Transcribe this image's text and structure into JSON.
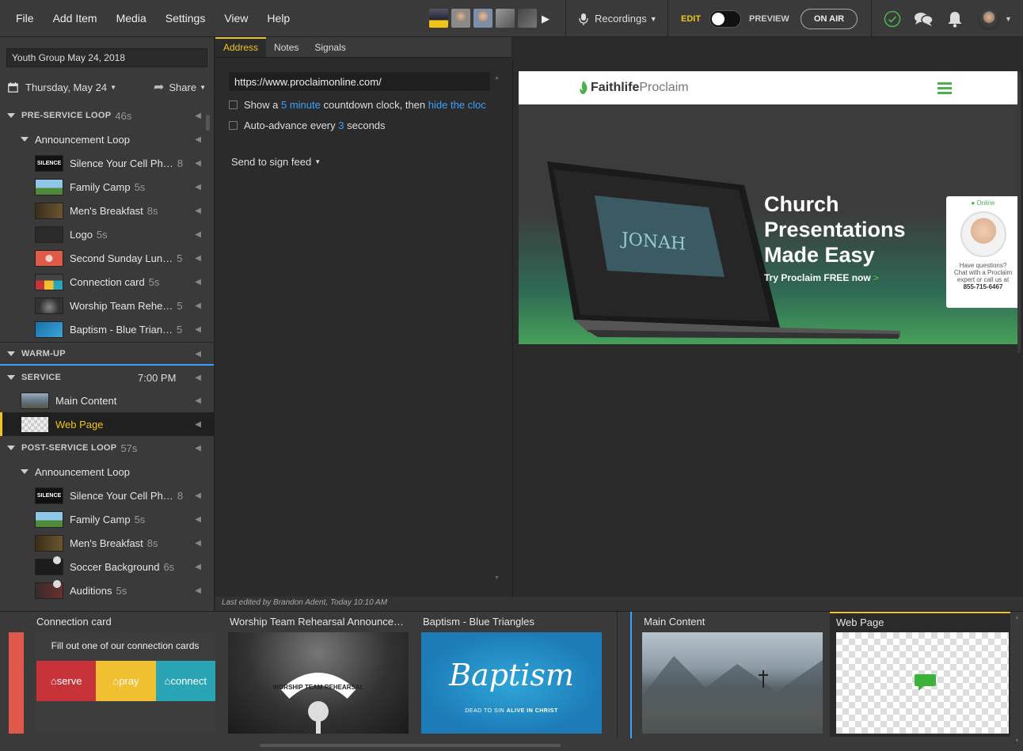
{
  "menu": [
    "File",
    "Add Item",
    "Media",
    "Settings",
    "View",
    "Help"
  ],
  "toolbar": {
    "recordings_label": "Recordings",
    "edit_label": "EDIT",
    "preview_label": "PREVIEW",
    "on_air_label": "ON AIR"
  },
  "sidebar": {
    "presentation_title": "Youth Group May 24, 2018",
    "date_label": "Thursday, May 24",
    "share_label": "Share",
    "pre_service": {
      "label": "PRE-SERVICE LOOP",
      "duration": "46s"
    },
    "announcement_loop_1": "Announcement Loop",
    "pre_items": [
      {
        "name": "Silence Your Cell Ph…",
        "dur": "8"
      },
      {
        "name": "Family Camp",
        "dur": "5s"
      },
      {
        "name": "Men's Breakfast",
        "dur": "8s"
      },
      {
        "name": "Logo",
        "dur": "5s"
      },
      {
        "name": "Second Sunday Lun…",
        "dur": "5"
      },
      {
        "name": "Connection card",
        "dur": "5s"
      },
      {
        "name": "Worship Team Rehe…",
        "dur": "5"
      },
      {
        "name": "Baptism - Blue Trian…",
        "dur": "5"
      }
    ],
    "warmup": {
      "label": "WARM-UP"
    },
    "service": {
      "label": "SERVICE",
      "time": "7:00 PM"
    },
    "service_items": [
      {
        "name": "Main Content"
      },
      {
        "name": "Web Page"
      }
    ],
    "post_service": {
      "label": "POST-SERVICE LOOP",
      "duration": "57s"
    },
    "announcement_loop_2": "Announcement Loop",
    "post_items": [
      {
        "name": "Silence Your Cell Ph…",
        "dur": "8"
      },
      {
        "name": "Family Camp",
        "dur": "5s"
      },
      {
        "name": "Men's Breakfast",
        "dur": "8s"
      },
      {
        "name": "Soccer Background",
        "dur": "6s"
      },
      {
        "name": "Auditions",
        "dur": "5s"
      }
    ]
  },
  "tabs": [
    "Address",
    "Notes",
    "Signals"
  ],
  "editor": {
    "url": "https://www.proclaimonline.com/",
    "countdown_pre": "Show a",
    "countdown_num": "5 minute",
    "countdown_mid": "countdown clock, then",
    "countdown_link": "hide the cloc",
    "advance_pre": "Auto-advance every",
    "advance_num": "3",
    "advance_post": "seconds",
    "send_to_feed": "Send to sign feed"
  },
  "webpage": {
    "logo_bold": "Faithlife",
    "logo_light": "Proclaim",
    "hero_line1": "Church",
    "hero_line2": "Presentations",
    "hero_line3": "Made Easy",
    "cta": "Try Proclaim FREE now",
    "laptop_title": "JONAH",
    "chat_status": "Online",
    "chat_text1": "Have questions?",
    "chat_text2": "Chat with a Proclaim",
    "chat_text3": "expert or call us at",
    "chat_phone": "855-715-6467"
  },
  "status_bar": "Last edited by Brandon Adent, Today 10:10 AM",
  "bottom_cards": [
    {
      "title": "Connection card",
      "header": "Fill out one of our connection cards",
      "b1": "serve",
      "b2": "pray",
      "b3": "connect"
    },
    {
      "title": "Worship Team Rehearsal Announce…",
      "badge": "WORSHIP TEAM REHEARSAL"
    },
    {
      "title": "Baptism - Blue Triangles",
      "script": "Baptism",
      "sub_a": "DEAD TO SIN",
      "sub_b": "ALIVE IN CHRIST"
    },
    {
      "title": "Main Content"
    },
    {
      "title": "Web Page"
    }
  ],
  "colors": {
    "accent": "#f0c419",
    "link": "#3aa0ff",
    "green": "#4caf50"
  }
}
